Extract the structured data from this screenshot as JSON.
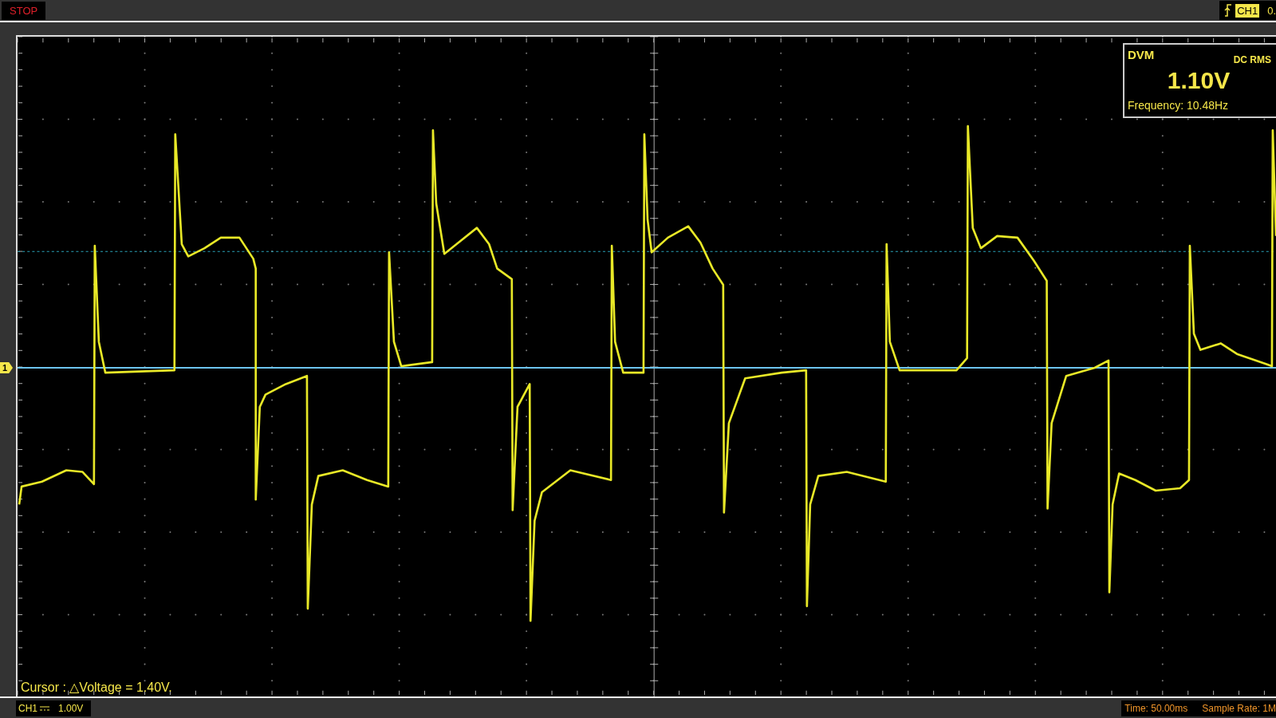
{
  "top_bar": {
    "run_status": "STOP",
    "trigger": {
      "channel": "CH1",
      "level": "0."
    }
  },
  "plot": {
    "channel_marker": "1",
    "dvm": {
      "title": "DVM",
      "mode": "DC RMS",
      "value": "1.10V",
      "frequency": "Frequency: 10.48Hz"
    },
    "cursor_readout": "Cursor : △Voltage = 1.40V."
  },
  "bottom_bar": {
    "channel": {
      "name": "CH1",
      "scale": "1.00V"
    },
    "time": "Time: 50.00ms",
    "sample_rate": "Sample Rate: 1M"
  }
}
